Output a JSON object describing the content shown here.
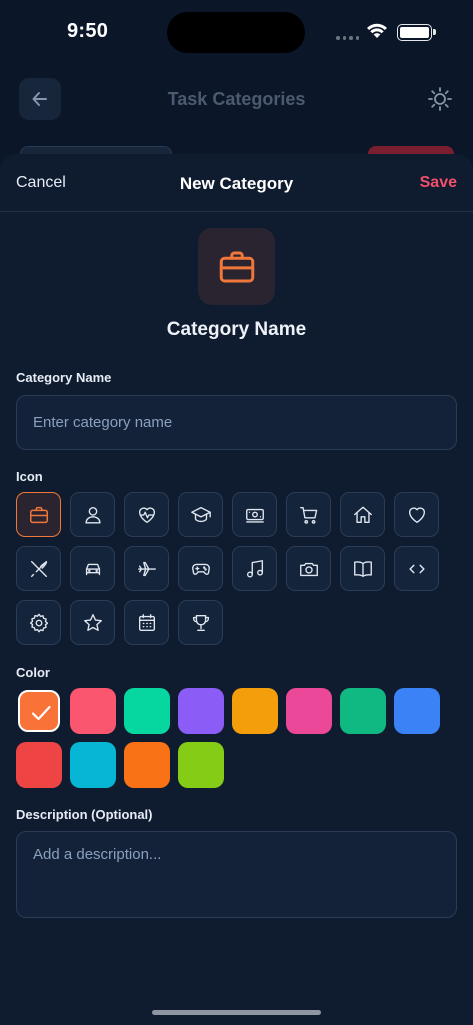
{
  "status_bar": {
    "time": "9:50"
  },
  "background_page": {
    "title": "Task Categories"
  },
  "sheet": {
    "cancel_label": "Cancel",
    "title": "New Category",
    "save_label": "Save"
  },
  "preview": {
    "icon": "briefcase-icon",
    "name": "Category Name"
  },
  "name_field": {
    "label": "Category Name",
    "placeholder": "Enter category name",
    "value": ""
  },
  "icon_section": {
    "label": "Icon",
    "selected": "briefcase",
    "icons": [
      "briefcase",
      "person",
      "heart-pulse",
      "graduation-cap",
      "money",
      "cart",
      "home",
      "heart",
      "utensils",
      "car",
      "plane",
      "gamepad",
      "music",
      "camera",
      "book",
      "code",
      "gear",
      "star",
      "calendar",
      "trophy"
    ]
  },
  "color_section": {
    "label": "Color",
    "selected": "#f97339",
    "colors": [
      "#f97339",
      "#fb5670",
      "#06d6a0",
      "#8b5cf6",
      "#f59e0b",
      "#ec4899",
      "#10b981",
      "#3b82f6",
      "#ef4444",
      "#06b6d4",
      "#f97316",
      "#84cc16"
    ]
  },
  "description_field": {
    "label": "Description (Optional)",
    "placeholder": "Add a description...",
    "value": ""
  },
  "theme": {
    "accent": "#f0773a",
    "save_color": "#f2506a",
    "background": "#0b1628",
    "sheet": "#0f1b2e"
  }
}
